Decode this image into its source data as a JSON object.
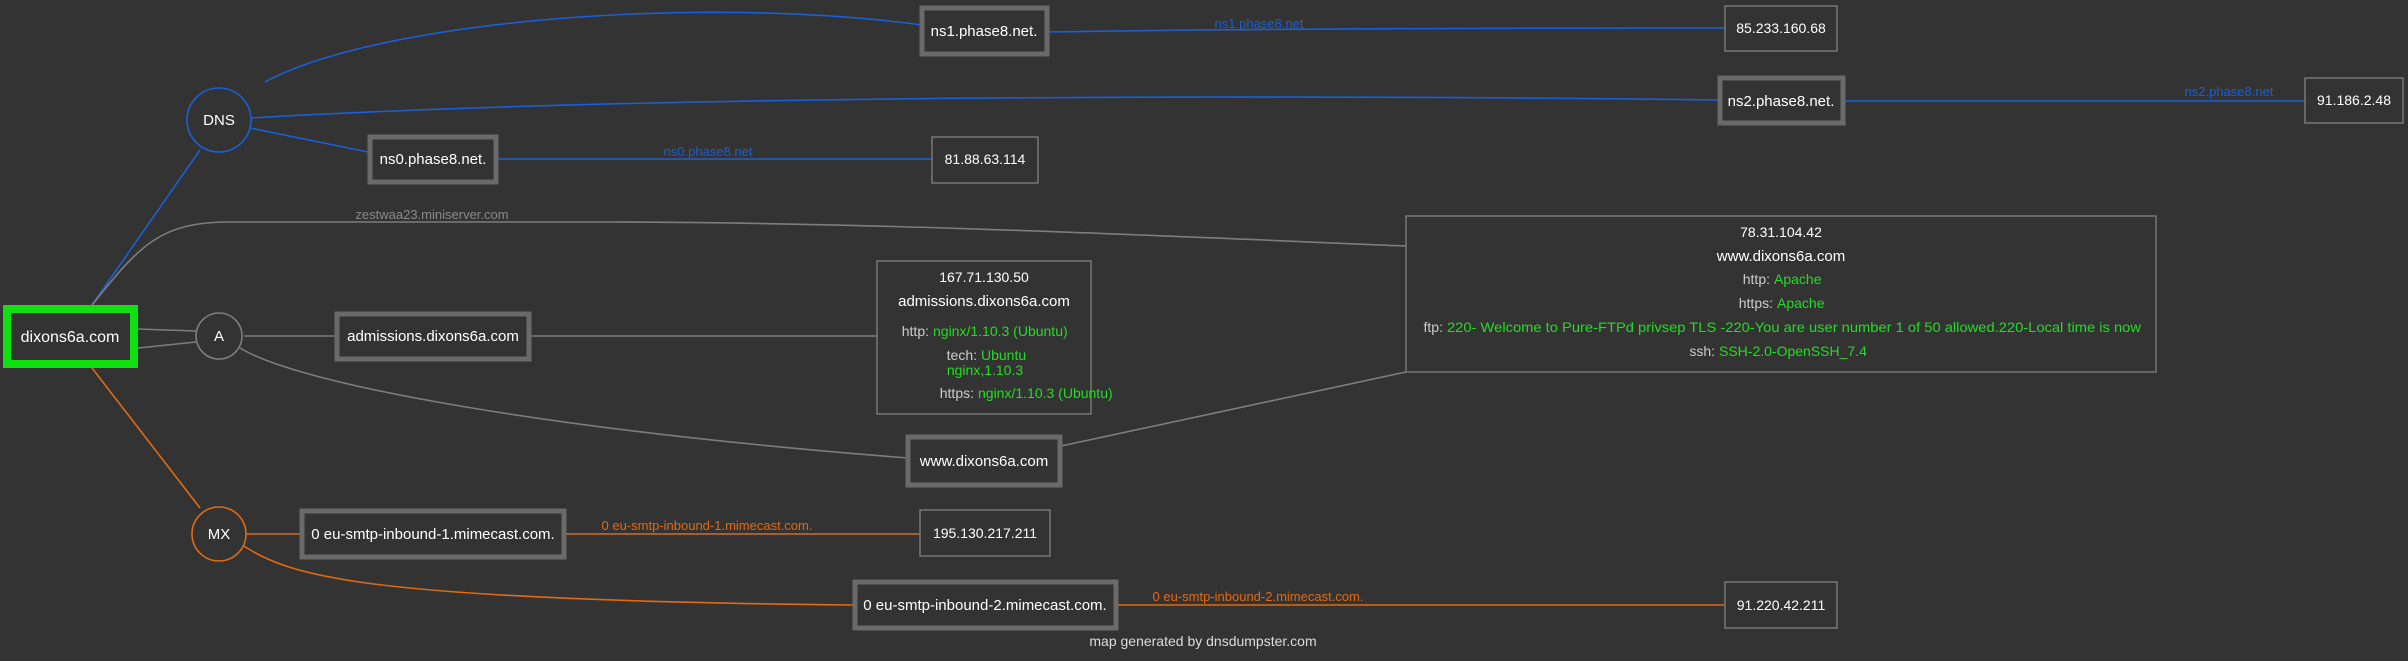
{
  "root": {
    "label": "dixons6a.com"
  },
  "record_types": {
    "dns": "DNS",
    "a": "A",
    "mx": "MX"
  },
  "ns_hosts": [
    {
      "name": "ns1.phase8.net.",
      "edge_label": "ns1.phase8.net",
      "ip": "85.233.160.68"
    },
    {
      "name": "ns2.phase8.net.",
      "edge_label": "ns2.phase8.net",
      "ip": "91.186.2.48"
    },
    {
      "name": "ns0.phase8.net.",
      "edge_label": "ns0.phase8.net",
      "ip": "81.88.63.114"
    }
  ],
  "a_hosts": [
    {
      "name": "admissions.dixons6a.com"
    },
    {
      "name": "www.dixons6a.com"
    }
  ],
  "mx_hosts": [
    {
      "name": "0 eu-smtp-inbound-1.mimecast.com.",
      "edge_label": "0 eu-smtp-inbound-1.mimecast.com.",
      "ip": "195.130.217.211"
    },
    {
      "name": "0 eu-smtp-inbound-2.mimecast.com.",
      "edge_label": "0 eu-smtp-inbound-2.mimecast.com.",
      "ip": "91.220.42.211"
    }
  ],
  "extra_edge_label": "zestwaa23.miniserver.com",
  "admissions_detail": {
    "ip": "167.71.130.50",
    "host": "admissions.dixons6a.com",
    "http_key": "http:",
    "http_val": "nginx/1.10.3 (Ubuntu)",
    "tech_key": "tech:",
    "tech_val1": "Ubuntu",
    "tech_val2": "nginx,1.10.3",
    "https_key": "https:",
    "https_val": "nginx/1.10.3 (Ubuntu)"
  },
  "www_detail": {
    "ip": "78.31.104.42",
    "host": "www.dixons6a.com",
    "http_key": "http:",
    "http_val": "Apache",
    "https_key": "https:",
    "https_val": "Apache",
    "ftp_key": "ftp:",
    "ftp_val": "220- Welcome to Pure-FTPd privsep TLS -220-You are user number 1 of 50 allowed.220-Local time is now",
    "ssh_key": "ssh:",
    "ssh_val": "SSH-2.0-OpenSSH_7.4"
  },
  "footer": "map generated by dnsdumpster.com",
  "colors": {
    "background": "#333333",
    "blue_edge": "#1a5fd6",
    "grey_edge": "#7d7d7d",
    "orange_edge": "#e06a12",
    "root_border": "#10e010",
    "node_border": "#6a6a6a",
    "text": "#ffffff",
    "green_text": "#22dd22"
  }
}
